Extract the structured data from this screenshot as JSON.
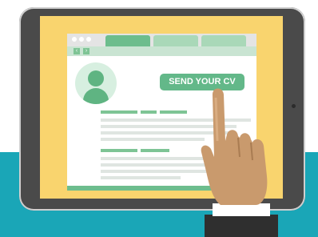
{
  "cta": {
    "label": "SEND YOUR CV"
  },
  "colors": {
    "background_band": "#1aa6b7",
    "tablet_frame": "#4a4a4a",
    "screen": "#f9d46e",
    "browser_tab_active": "#6dbd8d",
    "browser_tab_inactive": "#a9d8b8",
    "button": "#63b889",
    "heading_line": "#7ec495",
    "text_line": "#dfe5e1",
    "skin": "#c99a6d",
    "sleeve": "#2f2f2f",
    "cuff": "#ffffff"
  },
  "icons": [
    "user-avatar-icon",
    "back-arrow-icon",
    "forward-arrow-icon",
    "pointing-hand-icon"
  ]
}
